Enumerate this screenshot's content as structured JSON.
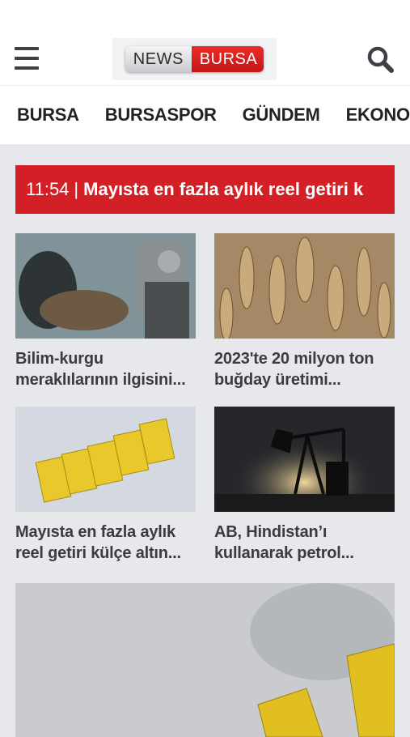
{
  "header": {
    "logo_left": "NEWS",
    "logo_right": "BURSA",
    "menu_icon": "hamburger-menu-icon",
    "search_icon": "search-icon"
  },
  "nav": {
    "items": [
      "BURSA",
      "BURSASPOR",
      "GÜNDEM",
      "EKONOMİ"
    ]
  },
  "ticker": {
    "time": "11:54",
    "separator": "|",
    "text": "Mayısta en fazla aylık reel getiri k"
  },
  "cards": [
    {
      "title": "Bilim-kurgu meraklılarının ilgisini..."
    },
    {
      "title": "2023'te 20 milyon ton buğday üretimi..."
    },
    {
      "title": "Mayısta en fazla aylık reel getiri külçe altın..."
    },
    {
      "title": "AB, Hindistan’ı kullanarak petrol..."
    }
  ],
  "colors": {
    "accent_red": "#d32027",
    "page_bg": "#e6e8ec"
  }
}
